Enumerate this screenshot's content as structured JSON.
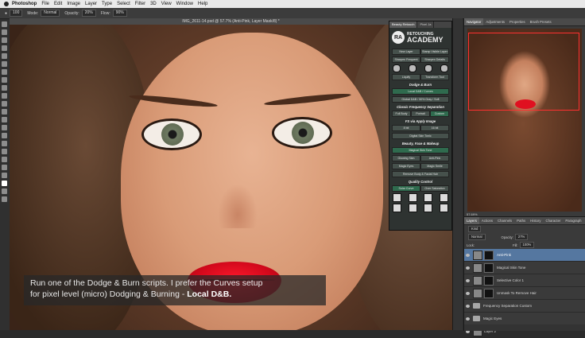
{
  "menubar": {
    "app": "Photoshop",
    "items": [
      "File",
      "Edit",
      "Image",
      "Layer",
      "Type",
      "Select",
      "Filter",
      "3D",
      "View",
      "Window",
      "Help"
    ]
  },
  "options": {
    "brush_size": "100",
    "mode_label": "Mode:",
    "mode_value": "Normal",
    "opacity_label": "Opacity:",
    "opacity_value": "20%",
    "flow_label": "Flow:",
    "flow_value": "90%"
  },
  "document": {
    "title": "IMG_2611-14.psd @ 57.7% (Anti-Pink, Layer Mask/8) *"
  },
  "caption": {
    "line1": "Run one of the Dodge & Burn scripts. I prefer the Curves setup",
    "line2": "for pixel level (micro) Dodging & Burning - ",
    "highlight": "Local D&B."
  },
  "retouch_panel": {
    "tabs": [
      "Beauty Retouch",
      "Pixel Ja"
    ],
    "logo_badge": "RA",
    "logo_line1": "RETOUCHING",
    "logo_line2": "ACADEMY",
    "row1": [
      "New Layer",
      "Stamp Visible Layer"
    ],
    "row2": [
      "Sharpen Frequent",
      "Sharpen Details"
    ],
    "row3": [
      "Liquify",
      "Transform Tool"
    ],
    "dodge_burn_head": "Dodge & Burn",
    "local_db": "Local D&B / Curves",
    "global_db": "Global D&B / 50% Gray / Soft",
    "classic_head": "Classic Frequency Separation",
    "row_fs": [
      "Full Body",
      "Portrait",
      "Custom"
    ],
    "fs_apply_head": "FS via Apply Image",
    "row_bit": [
      "8 bit",
      "16 bit"
    ],
    "digital_skin": "Digital Skin Tonic",
    "beauty_head": "Beauty, Face & Makeup",
    "magical_skin": "Magical Skin Tone",
    "row_glow": [
      "Glowing Skin",
      "Anti-Pink"
    ],
    "row_magic": [
      "Magic Eyes",
      "Magic Smile"
    ],
    "remove_hair": "Remove Body & Facial Hair",
    "quality_head": "Quality Control",
    "row_quality": [
      "Solar Curve",
      "Over Saturation"
    ]
  },
  "navigator": {
    "tabs": [
      "Navigator",
      "Adjustments",
      "Properties",
      "Brush Presets"
    ],
    "zoom": "57.69%"
  },
  "layers_panel": {
    "tabs": [
      "Layers",
      "Actions",
      "Channels",
      "Paths",
      "History",
      "Character",
      "Paragraph"
    ],
    "kind_label": "Kind",
    "blend_mode": "Normal",
    "opacity_label": "Opacity:",
    "opacity_value": "27%",
    "lock_label": "Lock:",
    "fill_label": "Fill:",
    "fill_value": "100%",
    "layers": [
      {
        "name": "Anti-Pink",
        "type": "masked",
        "selected": true
      },
      {
        "name": "Magical Skin Tone",
        "type": "masked",
        "selected": false
      },
      {
        "name": "Selective Color 1",
        "type": "masked",
        "selected": false
      },
      {
        "name": "Unmask To Remove Hair",
        "type": "masked",
        "selected": false
      },
      {
        "name": "Frequency Separation Custom",
        "type": "folder",
        "selected": false
      },
      {
        "name": "Magic Eyes",
        "type": "folder",
        "selected": false
      },
      {
        "name": "Layer 2",
        "type": "pixel",
        "selected": false
      }
    ]
  }
}
